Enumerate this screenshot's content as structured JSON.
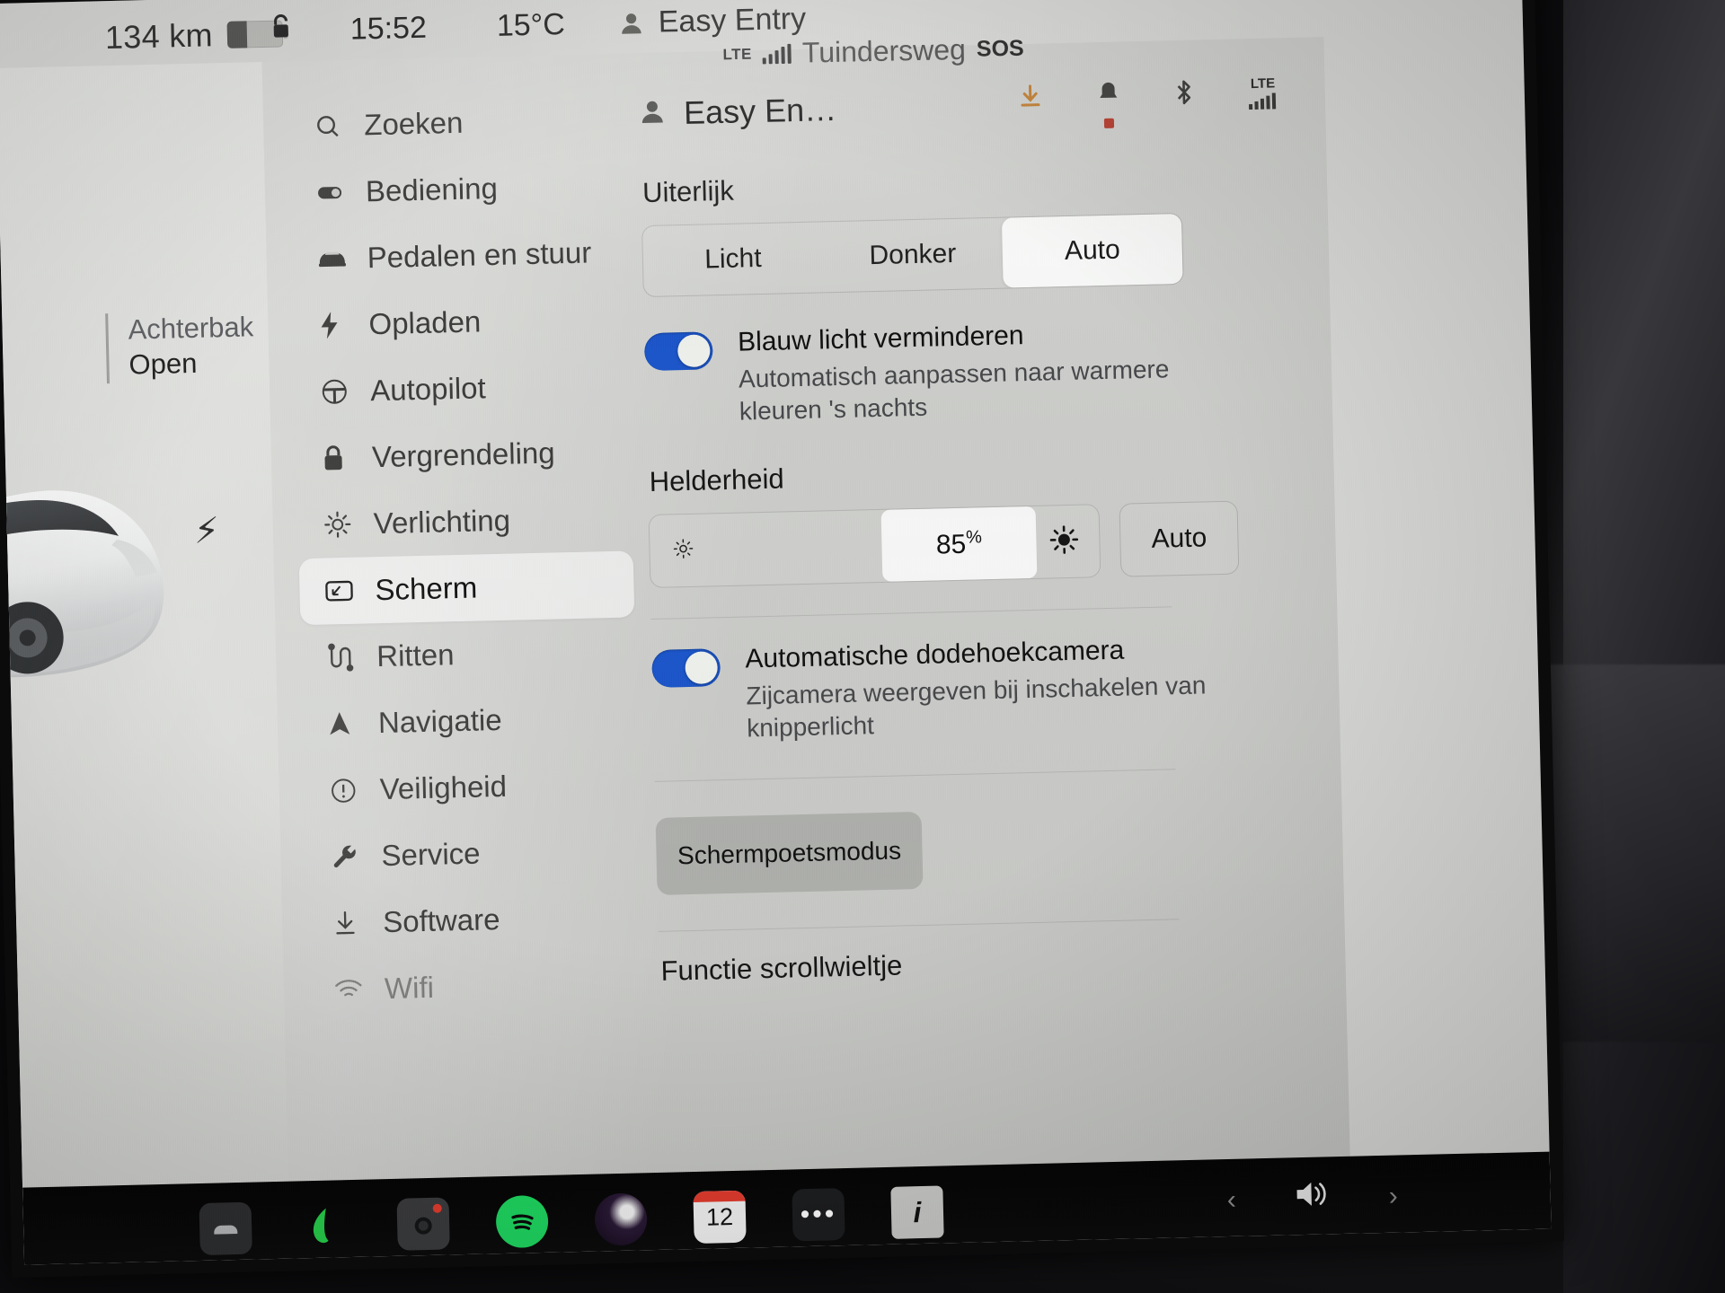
{
  "status_bar": {
    "range": "134 km",
    "battery_level_pct": 36,
    "lock_icon": "unlock-icon",
    "clock": "15:52",
    "temperature": "15°C",
    "profile_icon": "person-icon",
    "profile_name": "Easy Entry",
    "network_label": "LTE",
    "signal_bars": 4,
    "location": "Tuindersweg",
    "sos_label": "SOS"
  },
  "car_panel": {
    "status_title": "Achterbak",
    "status_value": "Open",
    "charge_icon": "lightning-bolt-icon"
  },
  "sidebar": {
    "items": [
      {
        "label": "Zoeken",
        "icon": "search-icon",
        "active": false
      },
      {
        "label": "Bediening",
        "icon": "toggle-icon",
        "active": false
      },
      {
        "label": "Pedalen en stuur",
        "icon": "car-icon",
        "active": false
      },
      {
        "label": "Opladen",
        "icon": "bolt-icon",
        "active": false
      },
      {
        "label": "Autopilot",
        "icon": "steering-wheel-icon",
        "active": false
      },
      {
        "label": "Vergrendeling",
        "icon": "lock-icon",
        "active": false
      },
      {
        "label": "Verlichting",
        "icon": "sun-icon",
        "active": false
      },
      {
        "label": "Scherm",
        "icon": "display-icon",
        "active": true
      },
      {
        "label": "Ritten",
        "icon": "route-icon",
        "active": false
      },
      {
        "label": "Navigatie",
        "icon": "navigation-arrow-icon",
        "active": false
      },
      {
        "label": "Veiligheid",
        "icon": "alert-circle-icon",
        "active": false
      },
      {
        "label": "Service",
        "icon": "wrench-icon",
        "active": false
      },
      {
        "label": "Software",
        "icon": "download-icon",
        "active": false
      },
      {
        "label": "Wifi",
        "icon": "wifi-icon",
        "active": false
      }
    ]
  },
  "detail": {
    "header_profile": "Easy En…",
    "header_icons": [
      {
        "name": "download-icon",
        "color": "#c07a2c",
        "badge": false
      },
      {
        "name": "bell-icon",
        "color": "#3a3b39",
        "badge": true
      },
      {
        "name": "bluetooth-icon",
        "color": "#3a3b39",
        "badge": false
      },
      {
        "name": "lte-signal-icon",
        "color": "#3a3b39",
        "badge": false,
        "label": "LTE"
      }
    ],
    "appearance": {
      "title": "Uiterlijk",
      "options": [
        "Licht",
        "Donker",
        "Auto"
      ],
      "selected": "Auto"
    },
    "blue_light": {
      "title": "Blauw licht verminderen",
      "subtitle": "Automatisch aanpassen naar warmere kleuren 's nachts",
      "enabled": true
    },
    "brightness": {
      "title": "Helderheid",
      "value": "85",
      "unit": "%",
      "value_pct": 85,
      "auto_label": "Auto",
      "low_icon": "brightness-low-icon",
      "high_icon": "brightness-high-icon"
    },
    "blind_spot": {
      "title": "Automatische dodehoekcamera",
      "subtitle": "Zijcamera weergeven bij inschakelen van knipperlicht",
      "enabled": true
    },
    "clean_screen_button": "Schermpoetsmodus",
    "scroll_wheel": {
      "title": "Functie scrollwieltje"
    }
  },
  "dock": {
    "apps": [
      {
        "name": "car-app-icon"
      },
      {
        "name": "leaf-app-icon"
      },
      {
        "name": "camera-app-icon"
      },
      {
        "name": "spotify-app-icon"
      },
      {
        "name": "media-ring-app-icon"
      },
      {
        "name": "calendar-app-icon",
        "label": "12"
      },
      {
        "name": "more-apps-icon",
        "label": "•••"
      },
      {
        "name": "info-manual-icon",
        "label": "i"
      }
    ],
    "prev_label": "‹",
    "next_label": "›",
    "volume_icon": "volume-icon"
  },
  "colors": {
    "accent_blue": "#1c55c8",
    "accent_orange": "#c07a2c",
    "badge_red": "#b33a2b",
    "screen_bg": "#cfd0cd"
  }
}
